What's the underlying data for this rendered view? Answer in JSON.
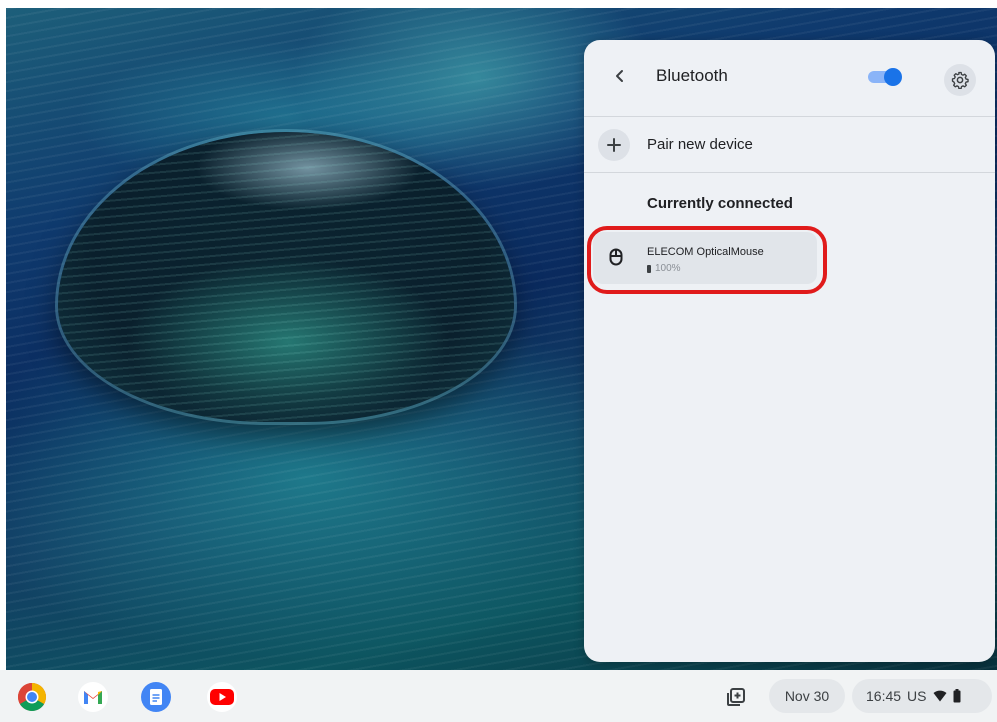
{
  "panel": {
    "title": "Bluetooth",
    "bluetooth_enabled": true,
    "pair_new_device": "Pair new device",
    "section_connected": "Currently connected",
    "devices": [
      {
        "name": "ELECOM OpticalMouse",
        "battery": "100%",
        "icon": "mouse-icon"
      }
    ]
  },
  "shelf": {
    "apps": [
      {
        "name": "Chrome",
        "icon": "chrome-icon"
      },
      {
        "name": "Gmail",
        "icon": "gmail-icon"
      },
      {
        "name": "Docs",
        "icon": "docs-icon"
      },
      {
        "name": "YouTube",
        "icon": "youtube-icon"
      }
    ],
    "date": "Nov 30",
    "time": "16:45",
    "input_method": "US"
  },
  "colors": {
    "accent": "#1a73e8",
    "highlight": "#e01b1b",
    "panel_bg": "#eef1f5"
  }
}
